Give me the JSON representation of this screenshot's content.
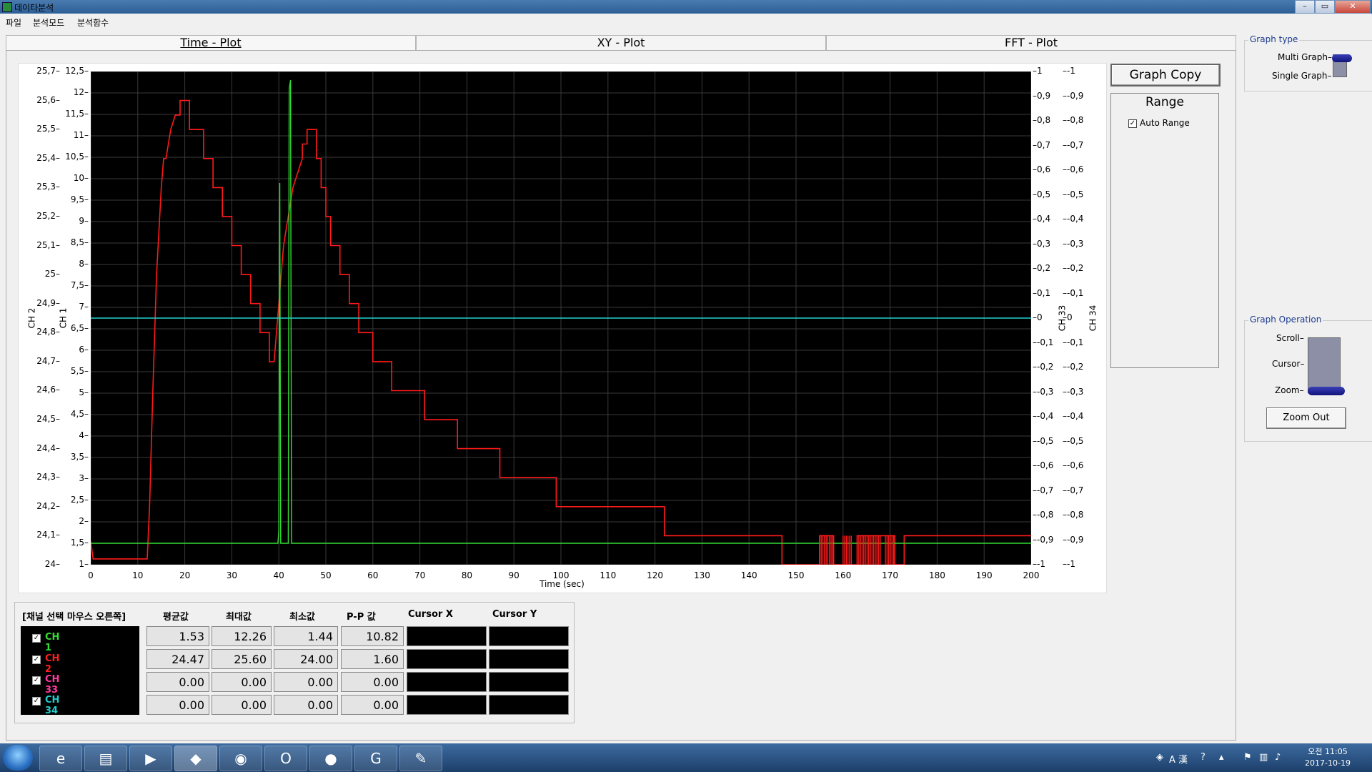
{
  "window": {
    "title": "데이타분석"
  },
  "menu": [
    "파일",
    "분석모드",
    "분석함수"
  ],
  "tabs": [
    "Time - Plot",
    "XY - Plot",
    "FFT - Plot"
  ],
  "chart_data": {
    "type": "line",
    "xlabel": "Time (sec)",
    "x_ticks": [
      0,
      10,
      20,
      30,
      40,
      50,
      60,
      70,
      80,
      90,
      100,
      110,
      120,
      130,
      140,
      150,
      160,
      170,
      180,
      190,
      200
    ],
    "xlim": [
      0,
      200
    ],
    "axes": {
      "ch2": {
        "label": "CH 2",
        "ylim": [
          24,
          25.7
        ],
        "ticks": [
          "25,7",
          "25,6",
          "25,5",
          "25,4",
          "25,3",
          "25,2",
          "25,1",
          "25",
          "24,9",
          "24,8",
          "24,7",
          "24,6",
          "24,5",
          "24,4",
          "24,3",
          "24,2",
          "24,1",
          "24"
        ]
      },
      "ch1": {
        "label": "CH 1",
        "ylim": [
          1,
          12.5
        ],
        "ticks": [
          "12,5",
          "12",
          "11,5",
          "11",
          "10,5",
          "10",
          "9,5",
          "9",
          "8,5",
          "8",
          "7,5",
          "7",
          "6,5",
          "6",
          "5,5",
          "5",
          "4,5",
          "4",
          "3,5",
          "3",
          "2,5",
          "2",
          "1,5",
          "1"
        ]
      },
      "ch33": {
        "label": "CH 33",
        "ylim": [
          -1,
          1
        ],
        "ticks": [
          "1",
          "0,9",
          "0,8",
          "0,7",
          "0,6",
          "0,5",
          "0,4",
          "0,3",
          "0,2",
          "0,1",
          "0",
          "-0,1",
          "-0,2",
          "-0,3",
          "-0,4",
          "-0,5",
          "-0,6",
          "-0,7",
          "-0,8",
          "-0,9",
          "-1"
        ]
      },
      "ch34": {
        "label": "CH 34",
        "ylim": [
          -1,
          1
        ],
        "ticks": [
          "-1",
          "-0,9",
          "-0,8",
          "-0,7",
          "-0,6",
          "-0,5",
          "-0,4",
          "-0,3",
          "-0,2",
          "-0,1",
          "0",
          "-0,1",
          "-0,2",
          "-0,3",
          "-0,4",
          "-0,5",
          "-0,6",
          "-0,7",
          "-0,8",
          "-0,9",
          "-1"
        ]
      }
    },
    "grid": true,
    "series": [
      {
        "name": "CH 2",
        "color": "#ff1a1a",
        "axis": "ch2",
        "points": [
          [
            0,
            24.08
          ],
          [
            0.5,
            24.02
          ],
          [
            10,
            24.02
          ],
          [
            12,
            24.02
          ],
          [
            12.5,
            24.2
          ],
          [
            13.2,
            24.6
          ],
          [
            14,
            25.0
          ],
          [
            15,
            25.3
          ],
          [
            15.5,
            25.4
          ],
          [
            16,
            25.4
          ],
          [
            16.5,
            25.45
          ],
          [
            17,
            25.5
          ],
          [
            18,
            25.55
          ],
          [
            19,
            25.55
          ],
          [
            19,
            25.6
          ],
          [
            20,
            25.6
          ],
          [
            21,
            25.6
          ],
          [
            21,
            25.5
          ],
          [
            22,
            25.5
          ],
          [
            23,
            25.5
          ],
          [
            24,
            25.5
          ],
          [
            24,
            25.4
          ],
          [
            25,
            25.4
          ],
          [
            26,
            25.4
          ],
          [
            26,
            25.3
          ],
          [
            28,
            25.3
          ],
          [
            28,
            25.2
          ],
          [
            30,
            25.2
          ],
          [
            30,
            25.1
          ],
          [
            32,
            25.1
          ],
          [
            32,
            25.0
          ],
          [
            34,
            25.0
          ],
          [
            34,
            24.9
          ],
          [
            36,
            24.9
          ],
          [
            36,
            24.8
          ],
          [
            37,
            24.8
          ],
          [
            38,
            24.8
          ],
          [
            38,
            24.7
          ],
          [
            39,
            24.7
          ],
          [
            39.5,
            24.8
          ],
          [
            40,
            24.9
          ],
          [
            40.5,
            25.0
          ],
          [
            41,
            25.1
          ],
          [
            42,
            25.2
          ],
          [
            43,
            25.3
          ],
          [
            44,
            25.35
          ],
          [
            45,
            25.4
          ],
          [
            45,
            25.45
          ],
          [
            46,
            25.45
          ],
          [
            46,
            25.5
          ],
          [
            48,
            25.5
          ],
          [
            48,
            25.4
          ],
          [
            49,
            25.4
          ],
          [
            49,
            25.3
          ],
          [
            50,
            25.3
          ],
          [
            50,
            25.2
          ],
          [
            51,
            25.2
          ],
          [
            51,
            25.1
          ],
          [
            53,
            25.1
          ],
          [
            53,
            25.0
          ],
          [
            55,
            25.0
          ],
          [
            55,
            24.9
          ],
          [
            57,
            24.9
          ],
          [
            57,
            24.8
          ],
          [
            60,
            24.8
          ],
          [
            60,
            24.7
          ],
          [
            64,
            24.7
          ],
          [
            64,
            24.6
          ],
          [
            71,
            24.6
          ],
          [
            71,
            24.5
          ],
          [
            78,
            24.5
          ],
          [
            78,
            24.4
          ],
          [
            87,
            24.4
          ],
          [
            87,
            24.3
          ],
          [
            99,
            24.3
          ],
          [
            99,
            24.2
          ],
          [
            122,
            24.2
          ],
          [
            122,
            24.1
          ],
          [
            147,
            24.1
          ],
          [
            147,
            24.0
          ],
          [
            155,
            24.0
          ],
          [
            155,
            24.1
          ],
          [
            158,
            24.1
          ],
          [
            158,
            24.0
          ],
          [
            163,
            24.0
          ],
          [
            163,
            24.1
          ],
          [
            171,
            24.1
          ],
          [
            171,
            24.0
          ],
          [
            173,
            24.0
          ],
          [
            173,
            24.1
          ],
          [
            200,
            24.1
          ]
        ]
      },
      {
        "name": "CH 1",
        "color": "#33dd33",
        "axis": "ch1",
        "points": [
          [
            0,
            1.5
          ],
          [
            39.5,
            1.5
          ],
          [
            39.8,
            1.5
          ],
          [
            40,
            1.8
          ],
          [
            40.2,
            9.9
          ],
          [
            40.4,
            1.5
          ],
          [
            40.8,
            1.5
          ],
          [
            42,
            1.5
          ],
          [
            42.2,
            12.1
          ],
          [
            42.5,
            12.3
          ],
          [
            42.7,
            1.5
          ],
          [
            43,
            1.5
          ],
          [
            200,
            1.5
          ]
        ]
      },
      {
        "name": "CH 33",
        "color": "#22cfcf",
        "axis": "ch33",
        "points": [
          [
            0,
            0
          ],
          [
            200,
            0
          ]
        ]
      }
    ]
  },
  "side": {
    "graph_copy": "Graph Copy",
    "range_title": "Range",
    "auto_range": "Auto Range",
    "auto_range_checked": true,
    "graph_type_title": "Graph type",
    "multi_graph": "Multi Graph",
    "single_graph": "Single Graph",
    "graph_type_selected": "Multi Graph",
    "graph_operation_title": "Graph Operation",
    "scroll": "Scroll",
    "cursor": "Cursor",
    "zoom": "Zoom",
    "graph_operation_selected": "Zoom",
    "zoom_out": "Zoom Out"
  },
  "stats": {
    "headers": [
      "[채널 선택 마우스 오른쪽]",
      "평균값",
      "최대값",
      "최소값",
      "P-P 값",
      "Cursor X",
      "Cursor Y"
    ],
    "rows": [
      {
        "channel": "CH 1",
        "color": "#33dd33",
        "avg": "1.53",
        "max": "12.26",
        "min": "1.44",
        "pp": "10.82"
      },
      {
        "channel": "CH 2",
        "color": "#ff2020",
        "avg": "24.47",
        "max": "25.60",
        "min": "24.00",
        "pp": "1.60"
      },
      {
        "channel": "CH 33",
        "color": "#ff3aa0",
        "avg": "0.00",
        "max": "0.00",
        "min": "0.00",
        "pp": "0.00"
      },
      {
        "channel": "CH 34",
        "color": "#22cfcf",
        "avg": "0.00",
        "max": "0.00",
        "min": "0.00",
        "pp": "0.00"
      }
    ]
  },
  "taskbar": {
    "time": "오전 11:05",
    "date": "2017-10-19",
    "ime": "A 漢"
  }
}
